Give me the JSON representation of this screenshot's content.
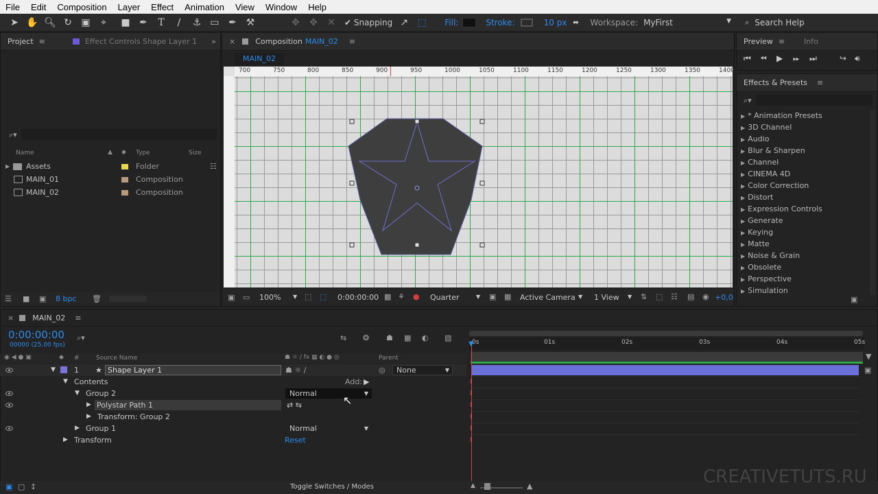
{
  "menu": [
    "File",
    "Edit",
    "Composition",
    "Layer",
    "Effect",
    "Animation",
    "View",
    "Window",
    "Help"
  ],
  "toolbar": {
    "snapping_label": "Snapping",
    "fill_label": "Fill:",
    "stroke_label": "Stroke:",
    "stroke_width": "10 px",
    "workspace_label": "Workspace:",
    "workspace_value": "MyFirst",
    "search_help": "Search Help"
  },
  "project_panel": {
    "tab": "Project",
    "effect_controls_tab": "Effect Controls Shape Layer 1",
    "columns": {
      "name": "Name",
      "type": "Type",
      "size": "Size"
    },
    "items": [
      {
        "name": "Assets",
        "type": "Folder",
        "color": "#e6d84a"
      },
      {
        "name": "MAIN_01",
        "type": "Composition",
        "color": "#b89a7a"
      },
      {
        "name": "MAIN_02",
        "type": "Composition",
        "color": "#b89a7a"
      }
    ],
    "bpc": "8 bpc"
  },
  "composition_panel": {
    "tab_label": "Composition",
    "tab_name": "MAIN_02",
    "subtab": "MAIN_02",
    "ruler_ticks": [
      "700",
      "750",
      "800",
      "850",
      "900",
      "950",
      "1000",
      "1050",
      "1100",
      "1150",
      "1200",
      "1250",
      "1300",
      "1350",
      "1400"
    ],
    "zoom": "100%",
    "timecode": "0:00:00:00",
    "resolution": "Quarter",
    "camera": "Active Camera",
    "view": "1 View",
    "exposure": "+0,0"
  },
  "preview_panel": {
    "tab": "Preview",
    "info_tab": "Info"
  },
  "effects_panel": {
    "tab": "Effects & Presets",
    "items": [
      "* Animation Presets",
      "3D Channel",
      "Audio",
      "Blur & Sharpen",
      "Channel",
      "CINEMA 4D",
      "Color Correction",
      "Distort",
      "Expression Controls",
      "Generate",
      "Keying",
      "Matte",
      "Noise & Grain",
      "Obsolete",
      "Perspective",
      "Simulation"
    ]
  },
  "timeline": {
    "tab": "MAIN_02",
    "timecode": "0:00:00:00",
    "fps": "00000 (25.00 fps)",
    "col_source": "Source Name",
    "col_parent": "Parent",
    "layer_num": "1",
    "layer_name": "Shape Layer 1",
    "parent_value": "None",
    "contents": "Contents",
    "add_label": "Add:",
    "group2": "Group 2",
    "group2_mode": "Normal",
    "polystar": "Polystar Path 1",
    "transform_group2": "Transform: Group 2",
    "group1": "Group 1",
    "group1_mode": "Normal",
    "transform": "Transform",
    "reset": "Reset",
    "time_ticks": [
      "0s",
      "01s",
      "02s",
      "03s",
      "04s",
      "05s"
    ],
    "toggle_label": "Toggle Switches / Modes"
  },
  "watermark": "CREATIVETUTS.RU"
}
